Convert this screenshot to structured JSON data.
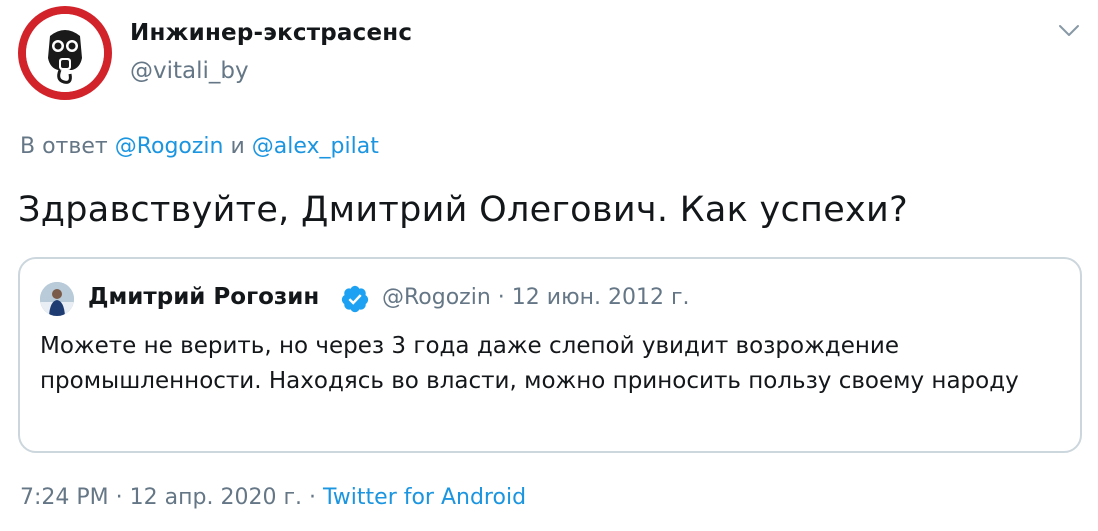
{
  "author": {
    "display_name": "Инжинер-экстрасенс",
    "handle": "@vitali_by"
  },
  "reply": {
    "prefix": "В ответ",
    "mention_1": "@Rogozin",
    "conjunction": "и",
    "mention_2": "@alex_pilat"
  },
  "tweet": {
    "text": "Здравствуйте, Дмитрий Олегович. Как успехи?"
  },
  "quoted_tweet": {
    "name": "Дмитрий Рогозин",
    "handle": "@Rogozin",
    "separator": "·",
    "date": "12 июн. 2012 г.",
    "text": "Можете не верить, но через 3 года даже слепой увидит возрождение промышленности. Находясь во власти, можно приносить пользу своему народу"
  },
  "footer": {
    "time": "7:24 PM",
    "sep1": "·",
    "date": "12 апр. 2020 г.",
    "sep2": "·",
    "source": "Twitter for Android"
  },
  "icons": {
    "avatar": "gas-mask-prohibition-sign-icon",
    "caret": "chevron-down-icon",
    "verified": "verified-badge-icon"
  },
  "colors": {
    "link": "#1b95e0",
    "secondary_text": "#657786",
    "primary_text": "#14171a",
    "border": "#ccd6dd",
    "verified": "#1da1f2",
    "avatar_ring": "#d2232a"
  }
}
